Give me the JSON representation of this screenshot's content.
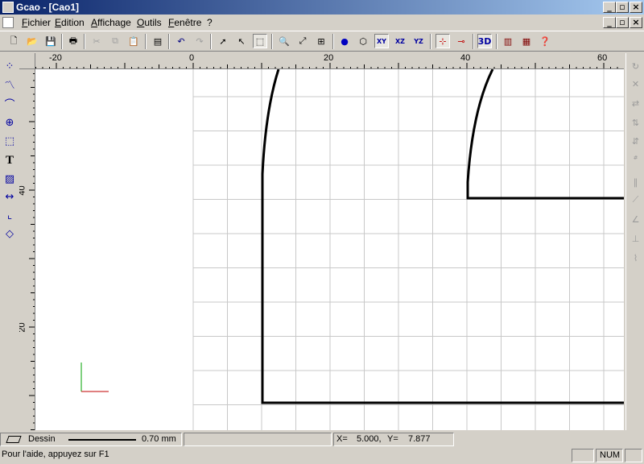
{
  "window": {
    "title": "Gcao - [Cao1]"
  },
  "menu": {
    "items": [
      "Fichier",
      "Edition",
      "Affichage",
      "Outils",
      "Fenêtre",
      "?"
    ]
  },
  "toolbar": {
    "btn_3d": "3D",
    "btn_xy": "XY",
    "btn_xz": "XZ",
    "btn_yz": "YZ"
  },
  "rulers": {
    "horizontal_labels": [
      "-20",
      "0",
      "20",
      "40",
      "60"
    ],
    "vertical_labels": [
      "40",
      "20"
    ]
  },
  "layer": {
    "name": "Dessin",
    "line_width": "0.70 mm"
  },
  "coords": {
    "x_label": "X=",
    "x_value": "5.000,",
    "y_label": "Y=",
    "y_value": "7.877"
  },
  "status": {
    "help_text": "Pour l'aide, appuyez sur F1",
    "num_indicator": "NUM"
  },
  "colors": {
    "title_start": "#0a246a",
    "title_end": "#a6caf0",
    "axis_x": "#c00000",
    "axis_y": "#00a000"
  }
}
